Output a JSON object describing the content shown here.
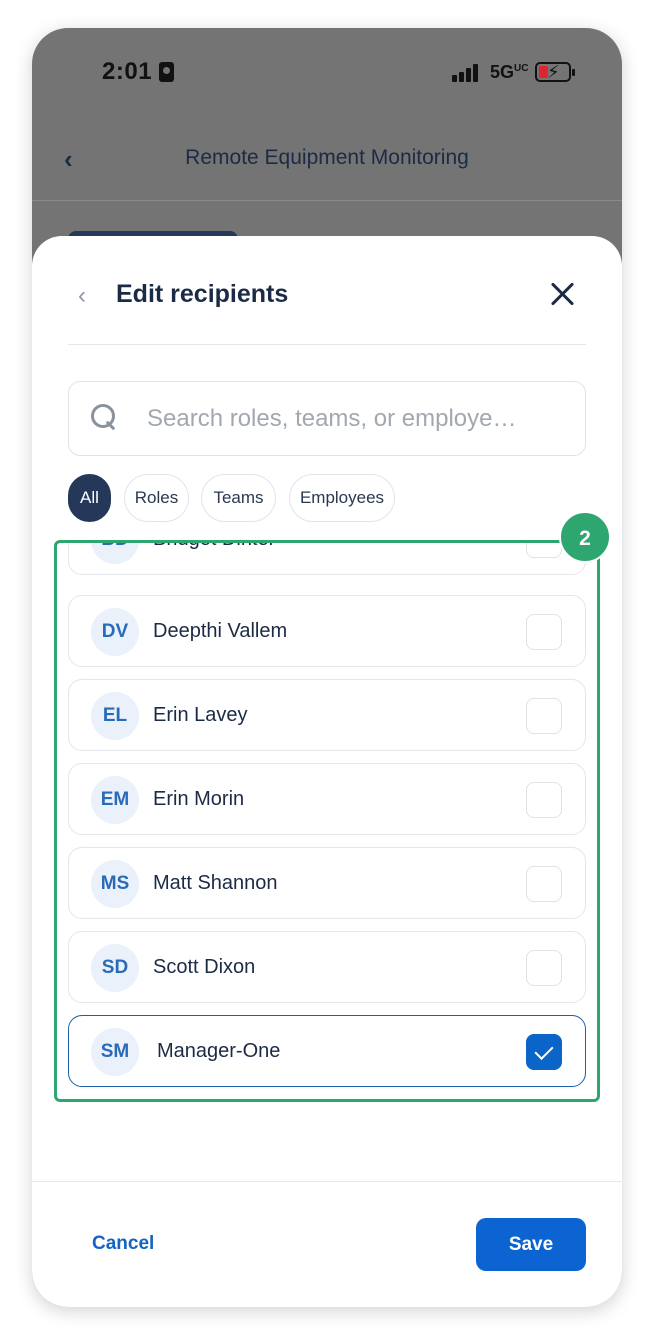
{
  "status_bar": {
    "time": "2:01",
    "network": "5G",
    "network_suffix": "UC"
  },
  "app_header": {
    "back_symbol": "‹",
    "title": "Remote Equipment Monitoring"
  },
  "sheet": {
    "back_symbol": "‹",
    "title": "Edit recipients",
    "search": {
      "placeholder": "Search roles, teams, or employe…",
      "value": ""
    },
    "filters": [
      {
        "label": "All",
        "active": true
      },
      {
        "label": "Roles",
        "active": false
      },
      {
        "label": "Teams",
        "active": false
      },
      {
        "label": "Employees",
        "active": false
      }
    ],
    "recipients": [
      {
        "initials": "BD",
        "name": "Bridget Dinter",
        "checked": false
      },
      {
        "initials": "DV",
        "name": "Deepthi Vallem",
        "checked": false
      },
      {
        "initials": "EL",
        "name": "Erin Lavey",
        "checked": false
      },
      {
        "initials": "EM",
        "name": "Erin Morin",
        "checked": false
      },
      {
        "initials": "MS",
        "name": "Matt Shannon",
        "checked": false
      },
      {
        "initials": "SD",
        "name": "Scott Dixon",
        "checked": false
      },
      {
        "initials": "SM",
        "name": "Manager-One",
        "checked": true
      }
    ],
    "annotation_badge": "2",
    "cancel_label": "Cancel",
    "save_label": "Save"
  },
  "colors": {
    "accent": "#0b64d1",
    "highlight_frame": "#2ea66f",
    "chip_active": "#26385a",
    "overlay": "#747474"
  }
}
